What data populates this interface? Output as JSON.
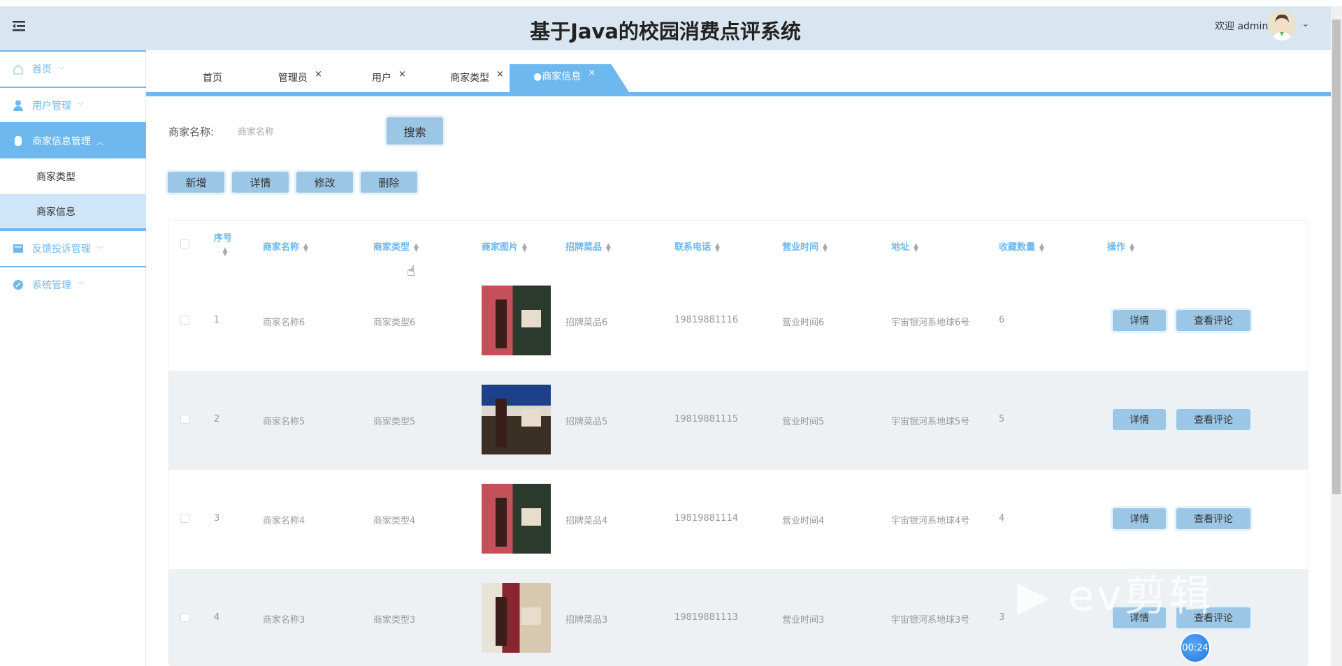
{
  "header": {
    "title": "基于Java的校园消费点评系统",
    "welcome": "欢迎 admin"
  },
  "sidebar": {
    "items": [
      {
        "label": "首页",
        "icon": "home-icon"
      },
      {
        "label": "用户管理",
        "icon": "user-icon"
      },
      {
        "label": "商家信息管理",
        "icon": "store-icon",
        "children": [
          "商家类型",
          "商家信息"
        ]
      },
      {
        "label": "反馈投诉管理",
        "icon": "feedback-icon"
      },
      {
        "label": "系统管理",
        "icon": "settings-icon"
      }
    ]
  },
  "tabs": [
    {
      "label": "首页"
    },
    {
      "label": "管理员"
    },
    {
      "label": "用户"
    },
    {
      "label": "商家类型"
    },
    {
      "label": "●商家信息"
    }
  ],
  "close_glyph": "×",
  "search": {
    "label": "商家名称:",
    "placeholder": "商家名称",
    "button": "搜索"
  },
  "toolbar": {
    "add": "新增",
    "detail": "详情",
    "edit": "修改",
    "delete": "删除"
  },
  "table": {
    "columns": [
      "序号",
      "商家名称",
      "商家类型",
      "商家图片",
      "招牌菜品",
      "联系电话",
      "营业时间",
      "地址",
      "收藏数量",
      "操作"
    ],
    "rows": [
      {
        "index": "1",
        "name": "商家名称6",
        "type": "商家类型6",
        "dish": "招牌菜品6",
        "phone": "19819881116",
        "hours": "营业时间6",
        "address": "宇宙银河系地球6号",
        "favorites": "6"
      },
      {
        "index": "2",
        "name": "商家名称5",
        "type": "商家类型5",
        "dish": "招牌菜品5",
        "phone": "19819881115",
        "hours": "营业时间5",
        "address": "宇宙银河系地球5号",
        "favorites": "5"
      },
      {
        "index": "3",
        "name": "商家名称4",
        "type": "商家类型4",
        "dish": "招牌菜品4",
        "phone": "19819881114",
        "hours": "营业时间4",
        "address": "宇宙银河系地球4号",
        "favorites": "4"
      },
      {
        "index": "4",
        "name": "商家名称3",
        "type": "商家类型3",
        "dish": "招牌菜品3",
        "phone": "19819881113",
        "hours": "营业时间3",
        "address": "宇宙银河系地球3号",
        "favorites": "3"
      }
    ],
    "row_actions": {
      "detail": "详情",
      "comments": "查看评论"
    }
  },
  "overlay": {
    "timer": "00:24",
    "watermark": "ev剪辑"
  }
}
